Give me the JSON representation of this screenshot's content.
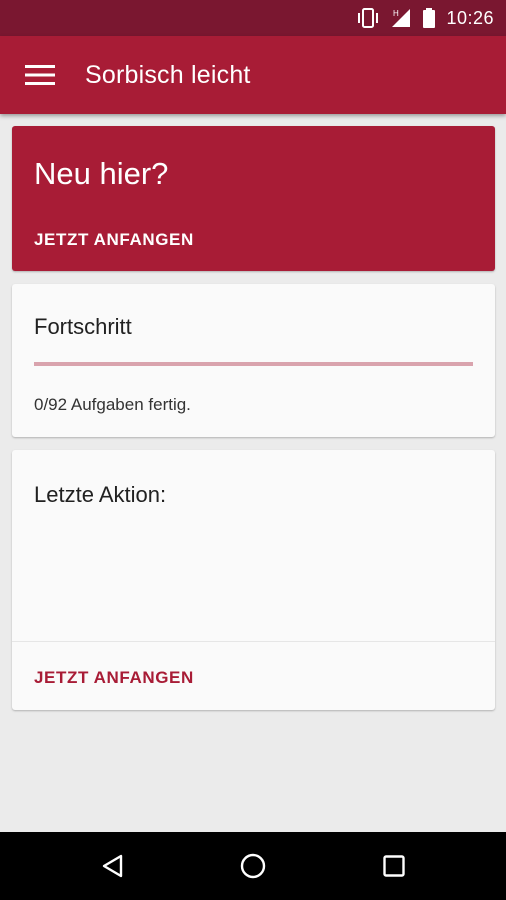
{
  "status_bar": {
    "time": "10:26",
    "icons": [
      "vibrate-icon",
      "signal-icon",
      "battery-icon"
    ]
  },
  "app_bar": {
    "title": "Sorbisch leicht",
    "menu_icon": "hamburger-menu-icon"
  },
  "welcome_card": {
    "title": "Neu hier?",
    "action_label": "JETZT ANFANGEN"
  },
  "progress_card": {
    "title": "Fortschritt",
    "progress_value": 0,
    "progress_text": "0/92 Aufgaben fertig."
  },
  "last_action_card": {
    "title": "Letzte Aktion:",
    "action_label": "JETZT ANFANGEN"
  },
  "nav_bar": {
    "buttons": [
      "back-icon",
      "home-icon",
      "recents-icon"
    ]
  },
  "colors": {
    "primary": "#a81c36",
    "primary_dark": "#7a1730",
    "progress_track": "#d9a3ad",
    "background": "#ebebeb",
    "card": "#fafafa"
  }
}
